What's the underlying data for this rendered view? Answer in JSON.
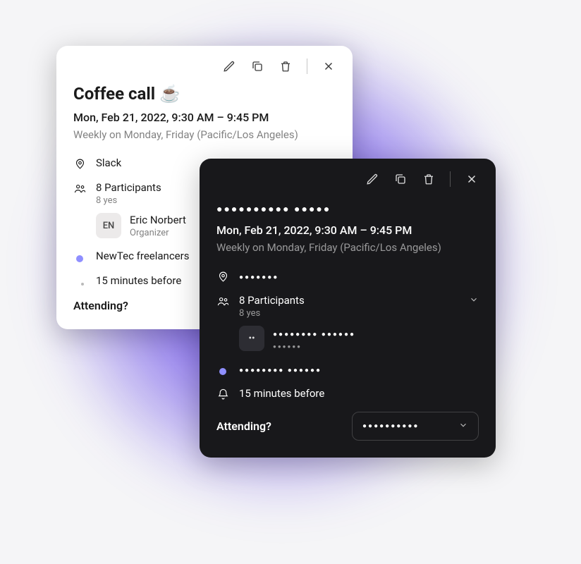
{
  "light": {
    "title": "Coffee call ☕",
    "datetime": "Mon, Feb 21, 2022, 9:30 AM – 9:45 PM",
    "recurrence": "Weekly on Monday, Friday (Pacific/Los Angeles)",
    "location": "Slack",
    "participants_label": "8 Participants",
    "participants_sub": "8 yes",
    "organizer_initials": "EN",
    "organizer_name": "Eric Norbert",
    "organizer_role": "Organizer",
    "calendar_name": "NewTec freelancers",
    "reminder": "15 minutes before",
    "attending_label": "Attending?"
  },
  "dark": {
    "title_dots": "●●●●●●●●●● ●●●●●",
    "datetime": "Mon, Feb 21, 2022, 9:30 AM – 9:45 PM",
    "recurrence": "Weekly on Monday, Friday (Pacific/Los Angeles)",
    "location_dots": "●●●●●●●",
    "participants_label": "8 Participants",
    "participants_sub": "8 yes",
    "organizer_initials": "••",
    "organizer_name_dots": "●●●●●●●● ●●●●●●",
    "organizer_role_dots": "●●●●●●",
    "calendar_dots": "●●●●●●●● ●●●●●●",
    "reminder": "15 minutes before",
    "attending_label": "Attending?",
    "dropdown_dots": "●●●●●●●●●●"
  },
  "colors": {
    "accent": "#8f8fff",
    "dark_bg": "#18181b"
  }
}
